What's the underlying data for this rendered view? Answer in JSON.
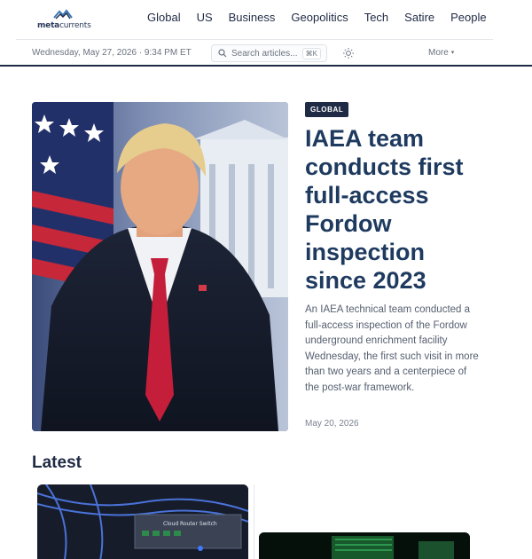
{
  "brand": {
    "logo_text_bold": "meta",
    "logo_text_rest": "currents"
  },
  "nav": {
    "items": [
      "Global",
      "US",
      "Business",
      "Geopolitics",
      "Tech",
      "Satire",
      "People"
    ]
  },
  "subbar": {
    "date": "Wednesday, May 27, 2026 · 9:34 PM ET",
    "search_placeholder": "Search articles...",
    "search_shortcut": "⌘K",
    "more_label": "More"
  },
  "hero": {
    "tag": "GLOBAL",
    "headline": "IAEA team conducts first full-access Fordow inspection since 2023",
    "summary": "An IAEA technical team conducted a full-access inspection of the Fordow underground enrichment facility Wednesday, the first such visit in more than two years and a centerpiece of the post-war framework.",
    "date": "May 20, 2026"
  },
  "latest": {
    "heading": "Latest",
    "cards": [
      {
        "image": "network-switch-photo",
        "device_label": "Cloud Router Switch"
      },
      {
        "image": "green-server-photo"
      }
    ]
  },
  "colors": {
    "accent": "#1e3a5f",
    "nav_text": "#1f2a44",
    "muted": "#6b7280",
    "tag_bg": "#1f2a44"
  }
}
